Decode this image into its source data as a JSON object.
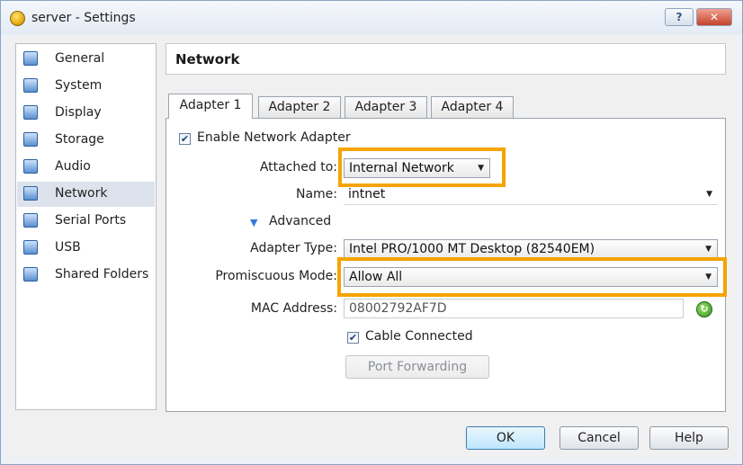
{
  "window": {
    "title": "server - Settings",
    "help_label": "?",
    "close_label": "✕"
  },
  "sidebar": {
    "items": [
      {
        "label": "General",
        "icon": "general-icon"
      },
      {
        "label": "System",
        "icon": "system-icon"
      },
      {
        "label": "Display",
        "icon": "display-icon"
      },
      {
        "label": "Storage",
        "icon": "storage-icon"
      },
      {
        "label": "Audio",
        "icon": "audio-icon"
      },
      {
        "label": "Network",
        "icon": "network-icon",
        "selected": true
      },
      {
        "label": "Serial Ports",
        "icon": "serial-ports-icon"
      },
      {
        "label": "USB",
        "icon": "usb-icon"
      },
      {
        "label": "Shared Folders",
        "icon": "shared-folders-icon"
      }
    ]
  },
  "section": {
    "title": "Network"
  },
  "tabs": [
    {
      "label": "Adapter 1",
      "active": true
    },
    {
      "label": "Adapter 2"
    },
    {
      "label": "Adapter 3"
    },
    {
      "label": "Adapter 4"
    }
  ],
  "form": {
    "enable_adapter_label": "Enable Network Adapter",
    "enable_adapter_checked": true,
    "attached_to_label": "Attached to:",
    "attached_to_value": "Internal Network",
    "name_label": "Name:",
    "name_value": "intnet",
    "advanced_label": "Advanced",
    "adapter_type_label": "Adapter Type:",
    "adapter_type_value": "Intel PRO/1000 MT Desktop (82540EM)",
    "promiscuous_label": "Promiscuous Mode:",
    "promiscuous_value": "Allow All",
    "mac_label": "MAC Address:",
    "mac_value": "08002792AF7D",
    "cable_connected_label": "Cable Connected",
    "cable_connected_checked": true,
    "port_forwarding_label": "Port Forwarding"
  },
  "buttons": {
    "ok": "OK",
    "cancel": "Cancel",
    "help": "Help"
  },
  "colors": {
    "highlight": "#f5a400",
    "selected_item": "#dde3ec"
  }
}
